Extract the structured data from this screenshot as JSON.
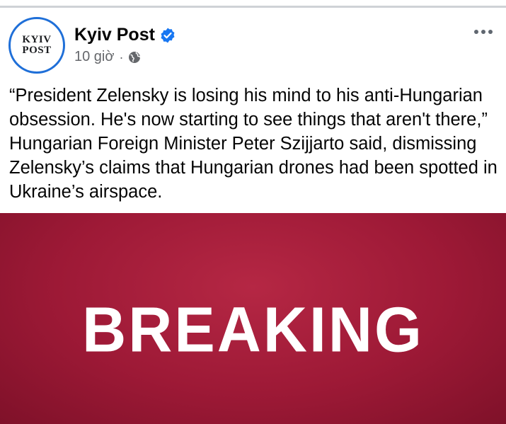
{
  "post": {
    "page_name": "Kyiv Post",
    "avatar": {
      "line1": "KYIV",
      "line2": "POST"
    },
    "time": "10 giờ",
    "separator": "·",
    "audience_icon": "globe-icon",
    "verified_icon": "verified-badge-icon",
    "more_icon": "more-options-icon",
    "text": "“President Zelensky is losing his mind to his anti-Hungarian obsession. He's now starting to see things that aren't there,” Hungarian Foreign Minister Peter Szijjarto said, dismissing Zelensky’s claims that Hungarian drones had been spotted in Ukraine’s airspace.",
    "image": {
      "headline": "BREAKING",
      "background_color": "#9d1936"
    }
  },
  "colors": {
    "verified_blue": "#1877f2",
    "secondary_text": "#65676b",
    "avatar_ring": "#1f6fd8"
  }
}
